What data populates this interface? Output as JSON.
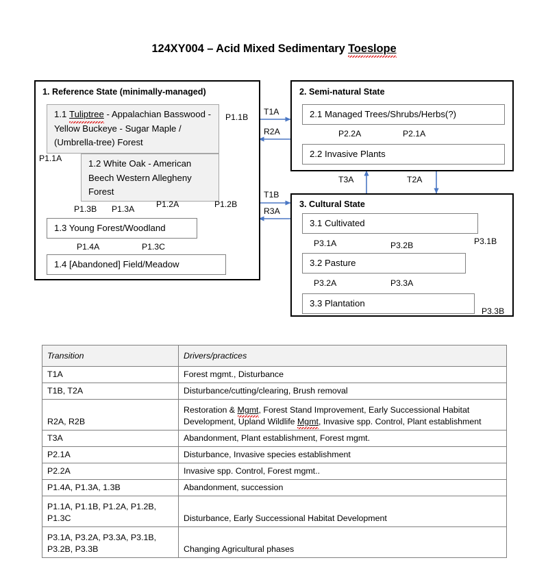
{
  "title": {
    "prefix": "124XY004 – Acid Mixed Sedimentary ",
    "misspelled": "Toeslope"
  },
  "states": [
    {
      "id": "state-1",
      "title": "1.  Reference State (minimally-managed)"
    },
    {
      "id": "state-2",
      "title": "2.  Semi-natural State"
    },
    {
      "id": "state-3",
      "title": "3.  Cultural State"
    }
  ],
  "phases": {
    "p11_line1_num": "1.1  ",
    "p11_misspelled": "Tuliptree",
    "p11_rest": " - Appalachian Basswood  - Yellow Buckeye - Sugar Maple / (Umbrella-tree) Forest",
    "p12": "1.2  White Oak - American Beech Western Allegheny Forest",
    "p13": "1.3  Young Forest/Woodland",
    "p14": "1.4  [Abandoned]  Field/Meadow",
    "p21": "2.1  Managed Trees/Shrubs/Herbs(?)",
    "p22": "2.2  Invasive Plants",
    "p31": "3.1  Cultivated",
    "p32": "3.2  Pasture",
    "p33": "3.3  Plantation"
  },
  "arrow_labels": {
    "p11a": "P1.1A",
    "p11b": "P1.1B",
    "p13b": "P1.3B",
    "p13a": "P1.3A",
    "p12a": "P1.2A",
    "p12b": "P1.2B",
    "p14a": "P1.4A",
    "p13c": "P1.3C",
    "t1a": "T1A",
    "r2a": "R2A",
    "t1b": "T1B",
    "r3a": "R3A",
    "p22a": "P2.2A",
    "p21a": "P2.1A",
    "t3a": "T3A",
    "t2a": "T2A",
    "p31a": "P3.1A",
    "p32b": "P3.2B",
    "p31b": "P3.1B",
    "p32a": "P3.2A",
    "p33a": "P3.3A",
    "p33b": "P3.3B"
  },
  "table": {
    "headers": [
      "Transition",
      "Drivers/practices"
    ],
    "rows": [
      {
        "transition": "T1A",
        "drivers": "Forest mgmt., Disturbance",
        "tall": false
      },
      {
        "transition": "T1B, T2A",
        "drivers": "Disturbance/cutting/clearing, Brush removal",
        "tall": false
      },
      {
        "transition": "R2A, R2B",
        "drivers_parts": [
          {
            "text": "Restoration & "
          },
          {
            "text": "Mgmt",
            "spell": true
          },
          {
            "text": ", Forest Stand Improvement, Early Successional Habitat Development, Upland Wildlife "
          },
          {
            "text": "Mgmt",
            "spell": true
          },
          {
            "text": ", Invasive spp. Control, Plant establishment"
          }
        ],
        "tall": true
      },
      {
        "transition": "T3A",
        "drivers": "Abandonment, Plant establishment, Forest mgmt.",
        "tall": false
      },
      {
        "transition": "P2.1A",
        "drivers": "Disturbance, Invasive species establishment",
        "tall": false
      },
      {
        "transition": "P2.2A",
        "drivers": "Invasive spp. Control, Forest mgmt..",
        "tall": false
      },
      {
        "transition": "P1.4A, P1.3A, 1.3B",
        "drivers": "Abandonment,  succession",
        "tall": false
      },
      {
        "transition": "P1.1A, P1.1B, P1.2A, P1.2B,\nP1.3C",
        "drivers": "Disturbance, Early Successional  Habitat Development",
        "tall": true
      },
      {
        "transition": "P3.1A, P3.2A, P3.3A, P3.1B,\nP3.2B, P3.3B",
        "drivers": "Changing Agricultural phases",
        "tall": true
      }
    ]
  },
  "colors": {
    "arrow_blue": "#4a77c4",
    "state_border": "#000000",
    "phase_border": "#808080",
    "phase_shaded_bg": "#f1f1f1",
    "table_border": "#7f7f7f",
    "table_header_bg": "#f2f2f2",
    "spellcheck_red": "#e02020"
  }
}
